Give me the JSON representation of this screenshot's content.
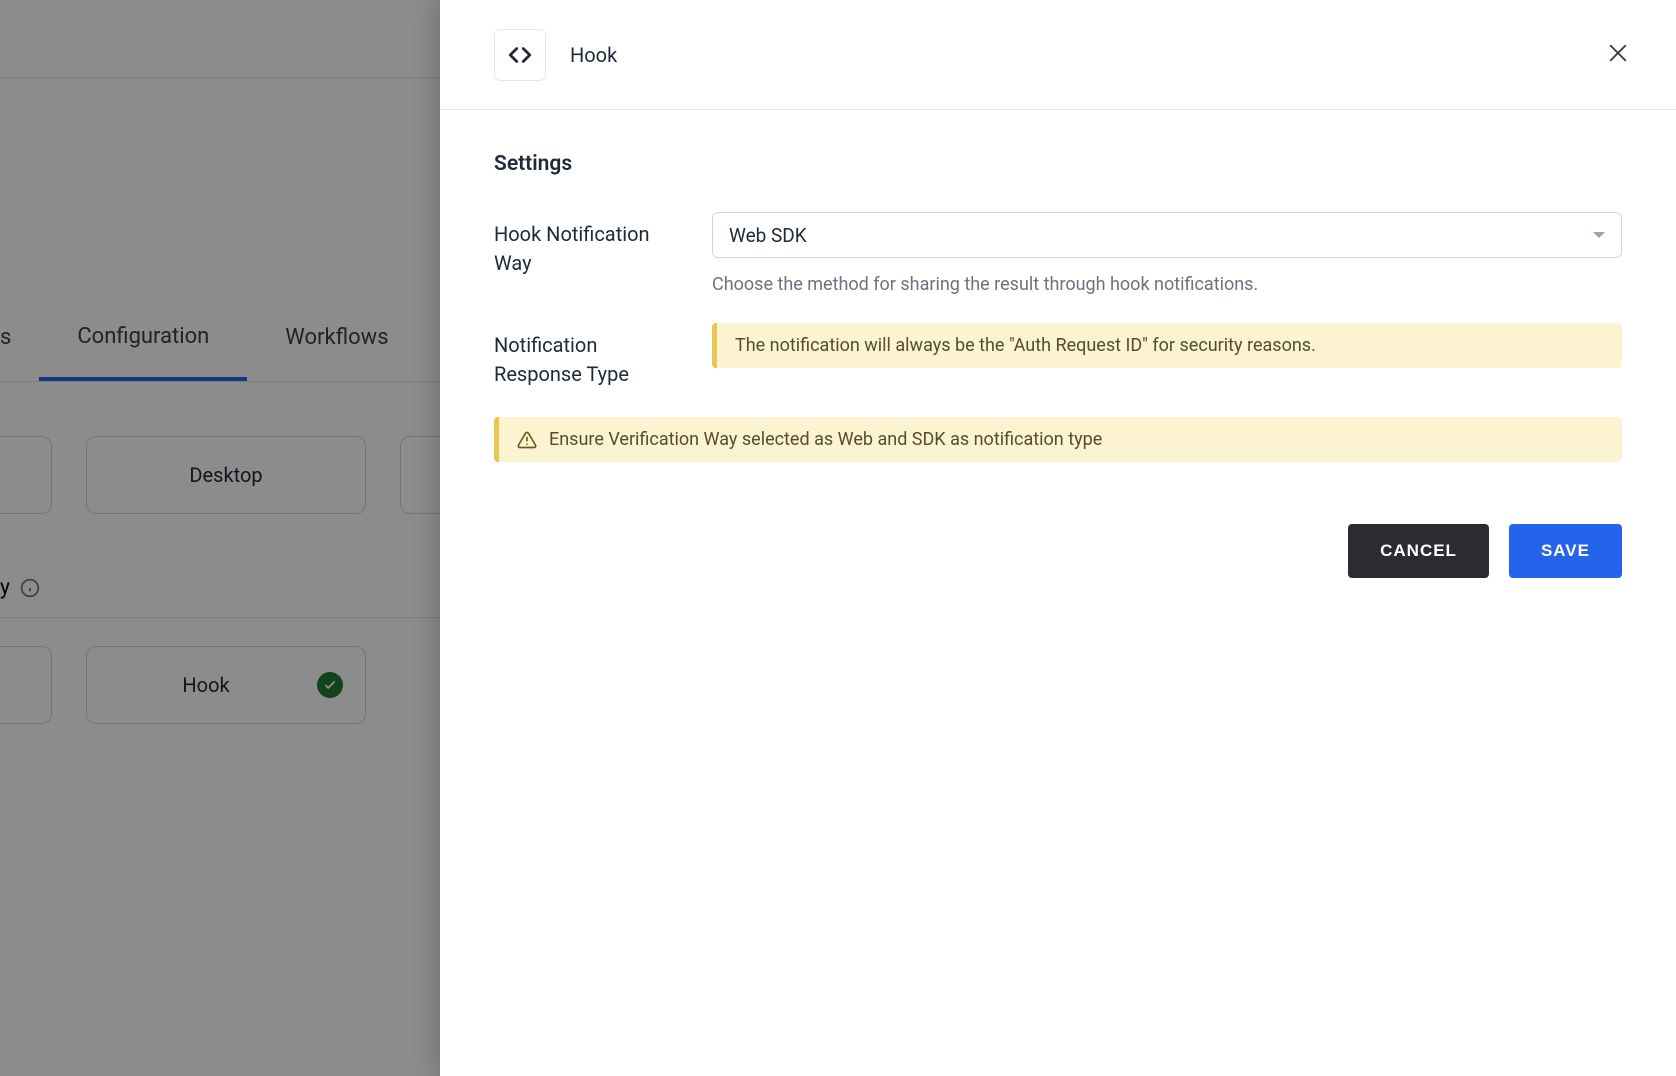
{
  "background": {
    "tabs": {
      "partial_left": "s",
      "configuration": "Configuration",
      "workflows": "Workflows"
    },
    "chips": {
      "desktop": "Desktop",
      "hook": "Hook"
    },
    "section_label_suffix": "y"
  },
  "drawer": {
    "title": "Hook",
    "section_heading": "Settings",
    "field1": {
      "label": "Hook Notification Way",
      "select_value": "Web SDK",
      "helper": "Choose the method for sharing the result through hook notifications."
    },
    "field2": {
      "label": "Notification Response Type",
      "alert": "The notification will always be the \"Auth Request ID\" for security reasons."
    },
    "alert_full": "Ensure Verification Way selected as Web and SDK as notification type",
    "buttons": {
      "cancel": "CANCEL",
      "save": "SAVE"
    }
  }
}
